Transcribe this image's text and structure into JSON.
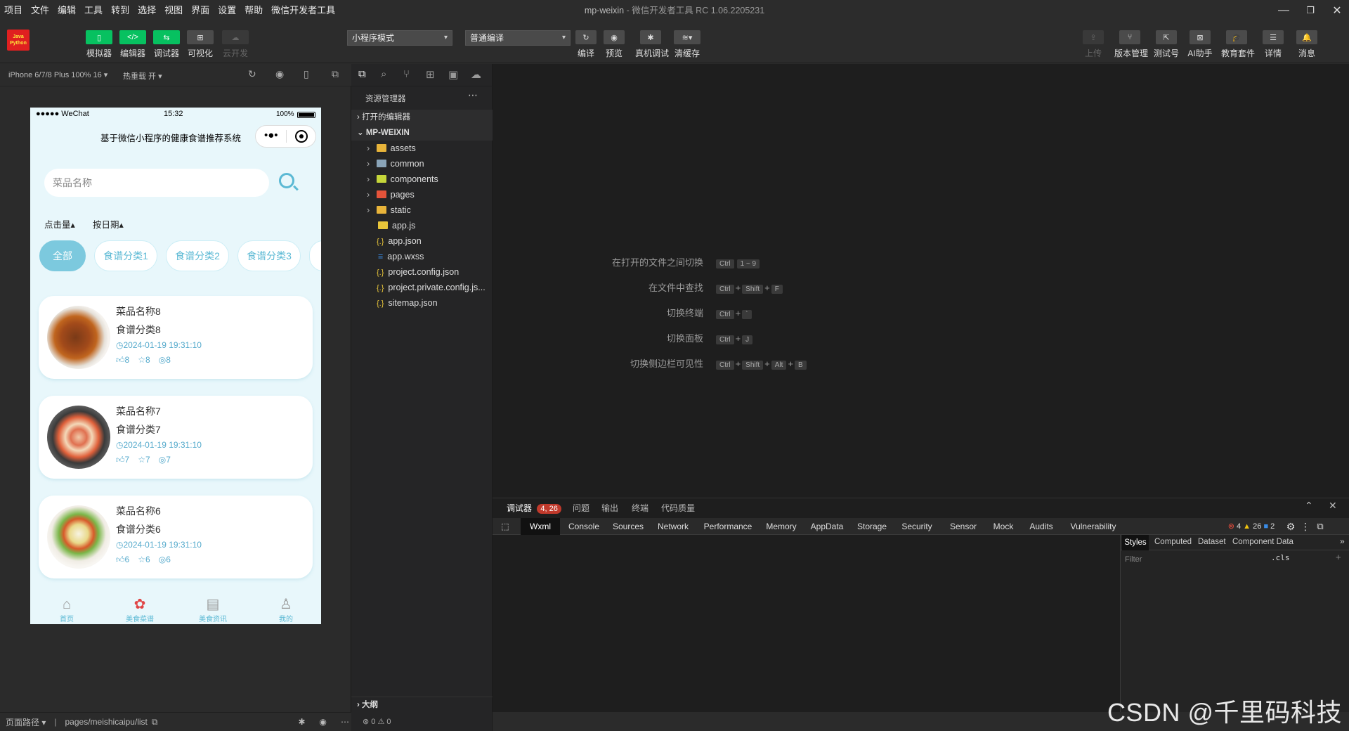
{
  "menubar": {
    "items": [
      "项目",
      "文件",
      "编辑",
      "工具",
      "转到",
      "选择",
      "视图",
      "界面",
      "设置",
      "帮助",
      "微信开发者工具"
    ],
    "title": "mp-weixin",
    "subtitle": "- 微信开发者工具 RC 1.06.2205231"
  },
  "toolbar": {
    "left_buttons": [
      "模拟器",
      "编辑器",
      "调试器",
      "可视化",
      "云开发"
    ],
    "mode_select": "小程序模式",
    "compile_select": "普通编译",
    "mid_buttons": [
      "编译",
      "预览",
      "真机调试",
      "清缓存"
    ],
    "right_buttons": [
      "上传",
      "版本管理",
      "测试号",
      "AI助手",
      "教育套件",
      "详情",
      "消息"
    ],
    "logo_text": "Java Python"
  },
  "simulator": {
    "device": "iPhone 6/7/8 Plus 100% 16",
    "hotreload": "热重载 开",
    "statusbar": {
      "carrier": "●●●●● WeChat",
      "time": "15:32",
      "battery": "100%"
    },
    "nav_title": "基于微信小程序的健康食谱推荐系统",
    "search_placeholder": "菜品名称",
    "sort": [
      "点击量",
      "按日期"
    ],
    "categories": [
      "全部",
      "食谱分类1",
      "食谱分类2",
      "食谱分类3"
    ],
    "recipes": [
      {
        "name": "菜品名称8",
        "category": "食谱分类8",
        "date": "2024-01-19 19:31:10",
        "likes": "8",
        "favs": "8",
        "views": "8"
      },
      {
        "name": "菜品名称7",
        "category": "食谱分类7",
        "date": "2024-01-19 19:31:10",
        "likes": "7",
        "favs": "7",
        "views": "7"
      },
      {
        "name": "菜品名称6",
        "category": "食谱分类6",
        "date": "2024-01-19 19:31:10",
        "likes": "6",
        "favs": "6",
        "views": "6"
      }
    ],
    "tabbar": [
      "首页",
      "美食菜谱",
      "美食资讯",
      "我的"
    ]
  },
  "simfoot": {
    "path_label": "页面路径",
    "path": "pages/meishicaipu/list"
  },
  "explorer": {
    "header": "资源管理器",
    "open_editors": "打开的编辑器",
    "project": "MP-WEIXIN",
    "folders": [
      "assets",
      "common",
      "components",
      "pages",
      "static"
    ],
    "files": [
      "app.js",
      "app.json",
      "app.wxss",
      "project.config.json",
      "project.private.config.js...",
      "sitemap.json"
    ],
    "outline": "大纲",
    "status": "⊗ 0 ⚠ 0"
  },
  "editor_hints": [
    {
      "label": "在打开的文件之间切换",
      "keys": [
        "Ctrl",
        "1 ~ 9"
      ]
    },
    {
      "label": "在文件中查找",
      "keys": [
        "Ctrl",
        "+",
        "Shift",
        "+",
        "F"
      ]
    },
    {
      "label": "切换终端",
      "keys": [
        "Ctrl",
        "+",
        "`"
      ]
    },
    {
      "label": "切换面板",
      "keys": [
        "Ctrl",
        "+",
        "J"
      ]
    },
    {
      "label": "切换侧边栏可见性",
      "keys": [
        "Ctrl",
        "+",
        "Shift",
        "+",
        "Alt",
        "+",
        "B"
      ]
    }
  ],
  "debugger": {
    "tabs": [
      "调试器",
      "问题",
      "输出",
      "终端",
      "代码质量"
    ],
    "badge": "4, 26",
    "devtools_tabs": [
      "Wxml",
      "Console",
      "Sources",
      "Network",
      "Performance",
      "Memory",
      "AppData",
      "Storage",
      "Security",
      "Sensor",
      "Mock",
      "Audits",
      "Vulnerability"
    ],
    "counts": {
      "errors": "4",
      "warnings": "26",
      "info": "2"
    },
    "style_tabs": [
      "Styles",
      "Computed",
      "Dataset",
      "Component Data"
    ],
    "filter_placeholder": "Filter",
    "cls": ".cls"
  },
  "watermark": "CSDN @千里码科技",
  "colors": {
    "accent": "#07c160",
    "phone_accent": "#5bb9d4",
    "badge": "#c0392b"
  }
}
